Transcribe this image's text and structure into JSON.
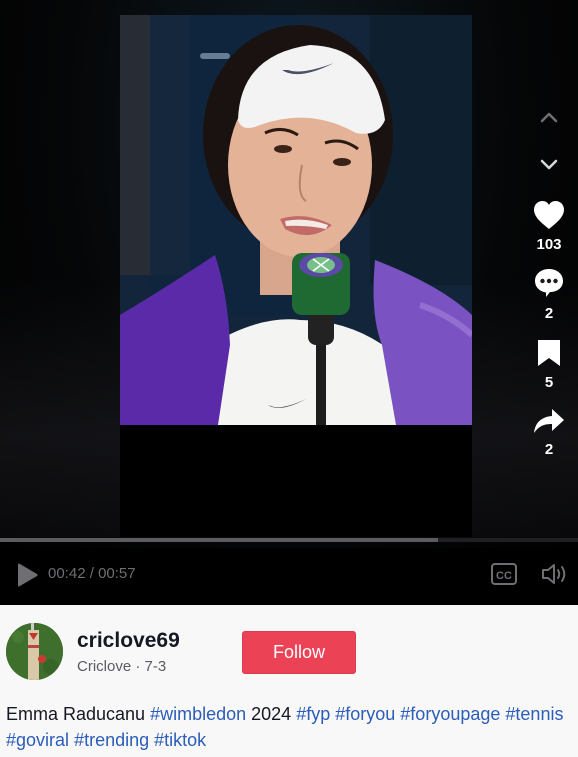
{
  "player": {
    "video_description": "Emma Raducanu speaking into a Wimbledon microphone, wearing a white visor and purple towel",
    "progress_fraction": 0.757,
    "time": {
      "current": "00:42",
      "separator": " / ",
      "total": "00:57"
    },
    "icons": {
      "play": "play-icon",
      "captions": "closed-captions-icon",
      "volume": "volume-icon"
    },
    "cc_label": "CC"
  },
  "side_actions": {
    "prev": "chevron-up-icon",
    "next": "chevron-down-icon",
    "items": [
      {
        "name": "like",
        "icon": "heart-icon",
        "count": "103"
      },
      {
        "name": "comment",
        "icon": "comment-icon",
        "count": "2"
      },
      {
        "name": "save",
        "icon": "bookmark-icon",
        "count": "5"
      },
      {
        "name": "share",
        "icon": "share-icon",
        "count": "2"
      }
    ]
  },
  "author": {
    "username": "criclove69",
    "display_name": "Criclove",
    "dot": " · ",
    "date": "7-3",
    "follow_label": "Follow"
  },
  "caption": {
    "segments": [
      {
        "text": "Emma Raducanu ",
        "type": "text"
      },
      {
        "text": "#wimbledon",
        "type": "hashtag"
      },
      {
        "text": " 2024 ",
        "type": "text"
      },
      {
        "text": "#fyp",
        "type": "hashtag"
      },
      {
        "text": " ",
        "type": "text"
      },
      {
        "text": "#foryou",
        "type": "hashtag"
      },
      {
        "text": " ",
        "type": "text"
      },
      {
        "text": "#foryoupage",
        "type": "hashtag"
      },
      {
        "text": " ",
        "type": "text"
      },
      {
        "text": "#tennis",
        "type": "hashtag"
      },
      {
        "text": " ",
        "type": "text"
      },
      {
        "text": "#goviral",
        "type": "hashtag"
      },
      {
        "text": " ",
        "type": "text"
      },
      {
        "text": "#trending",
        "type": "hashtag"
      },
      {
        "text": " ",
        "type": "text"
      },
      {
        "text": "#tiktok",
        "type": "hashtag"
      }
    ]
  },
  "colors": {
    "follow": "#eb4256",
    "hashtag": "#2b5db9",
    "progress_fill": "#5c5c60"
  }
}
